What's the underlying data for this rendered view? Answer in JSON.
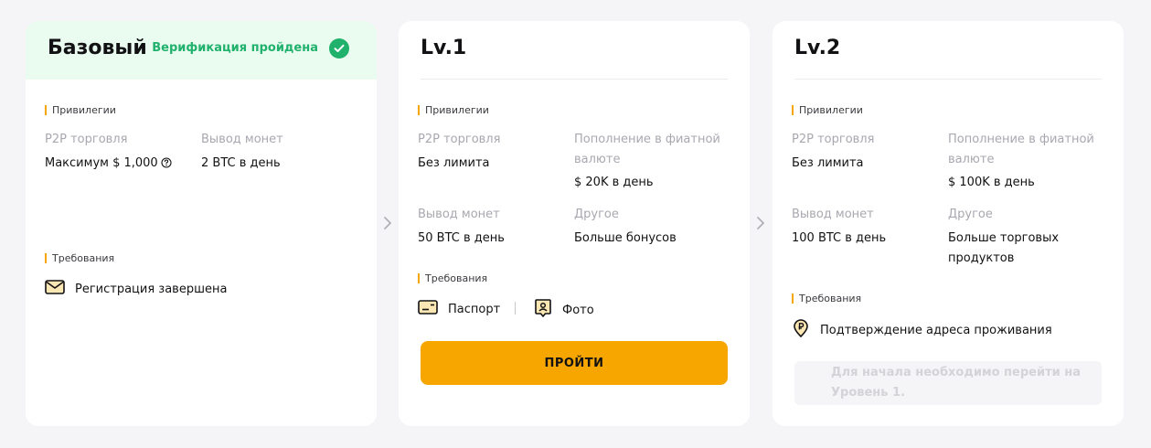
{
  "cards": [
    {
      "title": "Базовый",
      "status": "Верификация пройдена",
      "privileges_label": "Привилегии",
      "privileges": [
        {
          "label": "P2P торговля",
          "value": "Максимум $ 1,000"
        },
        {
          "label": "Вывод монет",
          "value": "2 BTC в день"
        }
      ],
      "requirements_label": "Требования",
      "requirements": [
        {
          "icon": "envelope-icon",
          "text": "Регистрация завершена"
        }
      ]
    },
    {
      "title": "Lv.1",
      "privileges_label": "Привилегии",
      "privileges": [
        {
          "label": "P2P торговля",
          "value": "Без лимита"
        },
        {
          "label": "Пополнение в фиатной валюте",
          "value": "$ 20K в день"
        },
        {
          "label": "Вывод монет",
          "value": "50 BTC в день"
        },
        {
          "label": "Другое",
          "value": "Больше бонусов"
        }
      ],
      "requirements_label": "Требования",
      "requirements": [
        {
          "icon": "id-card-icon",
          "text": "Паспорт"
        },
        {
          "icon": "photo-portrait-icon",
          "text": "Фото"
        }
      ],
      "button_label": "ПРОЙТИ"
    },
    {
      "title": "Lv.2",
      "privileges_label": "Привилегии",
      "privileges": [
        {
          "label": "P2P торговля",
          "value": "Без лимита"
        },
        {
          "label": "Пополнение в фиатной валюте",
          "value": "$ 100K в день"
        },
        {
          "label": "Вывод монет",
          "value": "100 BTC в день"
        },
        {
          "label": "Другое",
          "value": "Больше торговых продуктов"
        }
      ],
      "requirements_label": "Требования",
      "requirements": [
        {
          "icon": "location-pin-icon",
          "text": "Подтверждение адреса проживания"
        }
      ],
      "note": "Для начала необходимо перейти на Уровень 1."
    }
  ],
  "colors": {
    "accent": "#f7a600",
    "success": "#20b26c",
    "success_bg": "#eafbf0",
    "muted_text": "#a8a8b0",
    "page_bg": "#f5f5f7"
  }
}
